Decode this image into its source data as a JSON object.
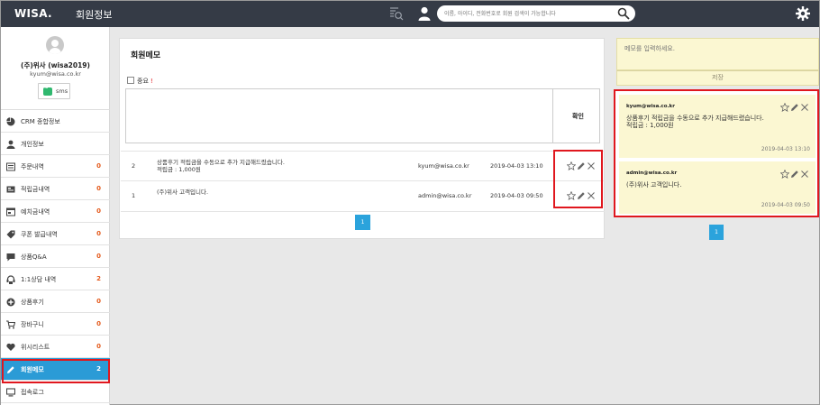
{
  "header": {
    "brand": "WISA.",
    "title": "회원정보",
    "search_placeholder": "이름, 아이디, 전화번호로 회원 검색이 가능합니다"
  },
  "profile": {
    "name": "(주)위사 (wisa2019)",
    "email": "kyum@wisa.co.kr",
    "sms_label": "sms"
  },
  "menu": [
    {
      "label": "CRM 종합정보",
      "count": "",
      "icon": "pie-chart-icon"
    },
    {
      "label": "개인정보",
      "count": "",
      "icon": "person-icon"
    },
    {
      "label": "주문내역",
      "count": "0",
      "icon": "order-list-icon"
    },
    {
      "label": "적립금내역",
      "count": "0",
      "icon": "points-icon"
    },
    {
      "label": "예치금내역",
      "count": "0",
      "icon": "deposit-icon"
    },
    {
      "label": "쿠폰 발급내역",
      "count": "0",
      "icon": "coupon-tag-icon"
    },
    {
      "label": "상품Q&A",
      "count": "0",
      "icon": "chat-bubble-icon"
    },
    {
      "label": "1:1상담 내역",
      "count": "2",
      "icon": "headset-icon"
    },
    {
      "label": "상품후기",
      "count": "0",
      "icon": "plus-circle-icon"
    },
    {
      "label": "장바구니",
      "count": "0",
      "icon": "cart-icon"
    },
    {
      "label": "위시리스트",
      "count": "0",
      "icon": "heart-icon"
    },
    {
      "label": "회원메모",
      "count": "2",
      "icon": "pencil-icon",
      "active": true
    },
    {
      "label": "접속로그",
      "count": "",
      "icon": "monitor-icon"
    }
  ],
  "memo": {
    "title": "회원메모",
    "important_label": "중요",
    "required_mark": "!",
    "confirm_header": "확인",
    "rows": [
      {
        "num": "2",
        "content": "상품후기 적립금을 수동으로 추가 지급해드렸습니다.\n적립금 : 1,000원",
        "author": "kyum@wisa.co.kr",
        "date": "2019-04-03 13:10"
      },
      {
        "num": "1",
        "content": "(주)위사 고객입니다.",
        "author": "admin@wisa.co.kr",
        "date": "2019-04-03 09:50"
      }
    ],
    "page": "1"
  },
  "notes": {
    "placeholder": "메모를 입력하세요.",
    "save_label": "저장",
    "items": [
      {
        "author": "kyum@wisa.co.kr",
        "content": "상품후기 적립금을 수동으로 추가 지급해드렸습니다.\n적립금 : 1,000원",
        "date": "2019-04-03 13:10"
      },
      {
        "author": "admin@wisa.co.kr",
        "content": "(주)위사 고객입니다.",
        "date": "2019-04-03 09:50"
      }
    ],
    "page": "1"
  },
  "colors": {
    "topbar": "#353b46",
    "accent": "#2b9bd6",
    "count": "#e45a1c",
    "highlight": "#e0171e",
    "note_bg": "#fbf7d2"
  }
}
